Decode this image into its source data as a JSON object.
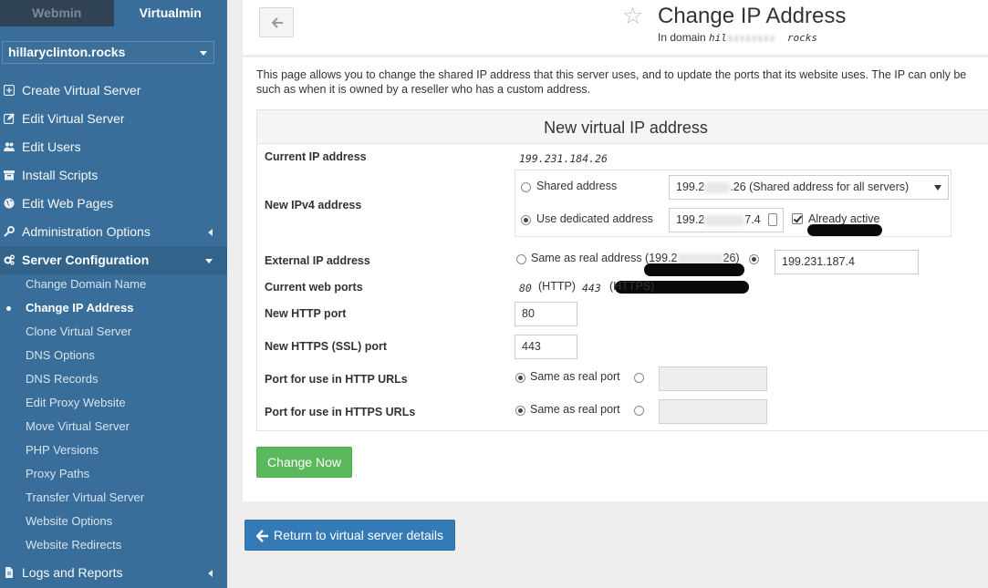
{
  "sidebar": {
    "tabs": [
      {
        "label": "Webmin",
        "active": false
      },
      {
        "label": "Virtualmin",
        "active": true
      }
    ],
    "domain_select": "hillaryclinton.rocks",
    "nav": [
      {
        "label": "Create Virtual Server",
        "icon": "plus-square-icon"
      },
      {
        "label": "Edit Virtual Server",
        "icon": "edit-icon"
      },
      {
        "label": "Edit Users",
        "icon": "users-icon"
      },
      {
        "label": "Install Scripts",
        "icon": "archive-icon"
      },
      {
        "label": "Edit Web Pages",
        "icon": "globe-icon"
      },
      {
        "label": "Administration Options",
        "icon": "wrench-icon"
      },
      {
        "label": "Server Configuration",
        "icon": "cogs-icon"
      },
      {
        "label": "Logs and Reports",
        "icon": "file-icon"
      }
    ],
    "server_config_items": [
      "Change Domain Name",
      "Change IP Address",
      "Clone Virtual Server",
      "DNS Options",
      "DNS Records",
      "Edit Proxy Website",
      "Move Virtual Server",
      "PHP Versions",
      "Proxy Paths",
      "Transfer Virtual Server",
      "Website Options",
      "Website Redirects"
    ],
    "current_item": "Change IP Address"
  },
  "header": {
    "title": "Change IP Address",
    "subtitle_prefix": "In domain",
    "domain_mono_start": "hil",
    "domain_mono_end": "rocks"
  },
  "intro": {
    "line1": "This page allows you to change the shared IP address that this server uses, and to update the ports that its website uses. The IP can only be",
    "line2": "such as when it is owned by a reseller who has a custom address."
  },
  "form": {
    "heading": "New virtual IP address",
    "current_ip_label": "Current IP address",
    "current_ip_value": "199.231.184.26",
    "ipv4_label": "New IPv4 address",
    "shared_option": "Shared address",
    "shared_select_start": "199.2",
    "shared_select_end": ".26 (Shared address for all servers)",
    "dedicated_option": "Use dedicated address",
    "dedicated_value_start": "199.2",
    "dedicated_value_end": "7.4",
    "already_active": "Already active",
    "external_label": "External IP address",
    "same_as_real_start": "Same as real address (199.2",
    "same_as_real_end": "26)",
    "external_value": "199.231.187.4",
    "ports_label": "Current web ports",
    "http_port": "80",
    "http_text": "(HTTP)",
    "https_port": "443",
    "https_text": "(HTTPS)",
    "new_http_label": "New HTTP port",
    "new_http_value": "80",
    "new_https_label": "New HTTPS (SSL) port",
    "new_https_value": "443",
    "http_url_label": "Port for use in HTTP URLs",
    "https_url_label": "Port for use in HTTPS URLs",
    "same_as_real_port": "Same as real port"
  },
  "buttons": {
    "change_now": "Change Now",
    "return": "Return to virtual server details"
  },
  "colors": {
    "sidebar": "#3a6e9a",
    "primary_button": "#337ab7",
    "success_button": "#5cb85c"
  }
}
